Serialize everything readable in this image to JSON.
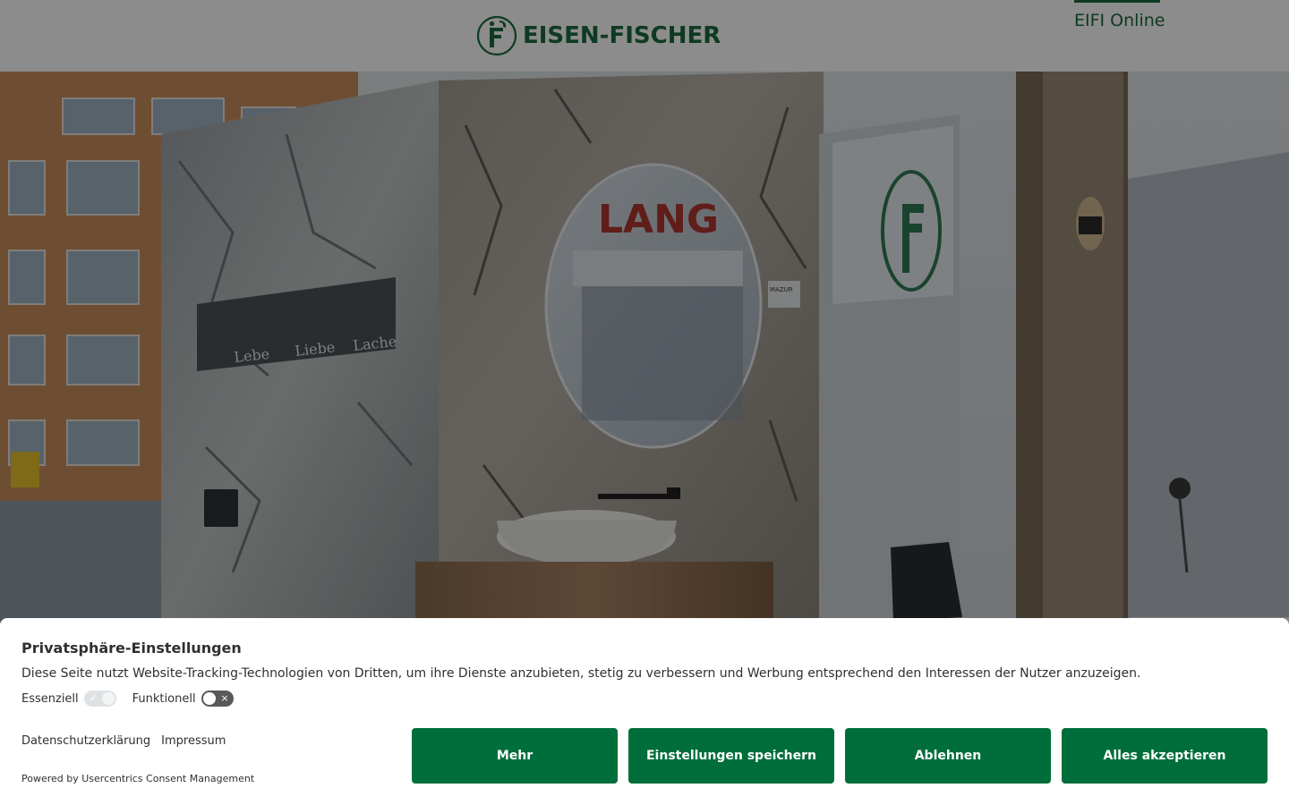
{
  "header": {
    "logo_text": "EISEN-FISCHER",
    "online_link": "EIFI Online",
    "brand_color": "#1b6b3c"
  },
  "hero": {
    "mirror_text": "LANG",
    "shelf_words": [
      "Lebe",
      "Liebe",
      "Lache"
    ],
    "product_label": "MAZUR"
  },
  "consent": {
    "title": "Privatsphäre-Einstellungen",
    "description": "Diese Seite nutzt Website-Tracking-Technologien von Dritten, um ihre Dienste anzubieten, stetig zu verbessern und Werbung entsprechend den Interessen der Nutzer anzuzeigen.",
    "toggles": [
      {
        "label": "Essenziell",
        "state": "on",
        "disabled": true
      },
      {
        "label": "Funktionell",
        "state": "off",
        "disabled": false
      }
    ],
    "links": {
      "privacy": "Datenschutzerklärung",
      "imprint": "Impressum"
    },
    "powered_by": "Powered by Usercentrics Consent Management",
    "buttons": {
      "more": "Mehr",
      "save": "Einstellungen speichern",
      "deny": "Ablehnen",
      "accept": "Alles akzeptieren"
    },
    "button_color": "#006e3a"
  },
  "icons": {
    "check": "✓",
    "cross": "×"
  }
}
